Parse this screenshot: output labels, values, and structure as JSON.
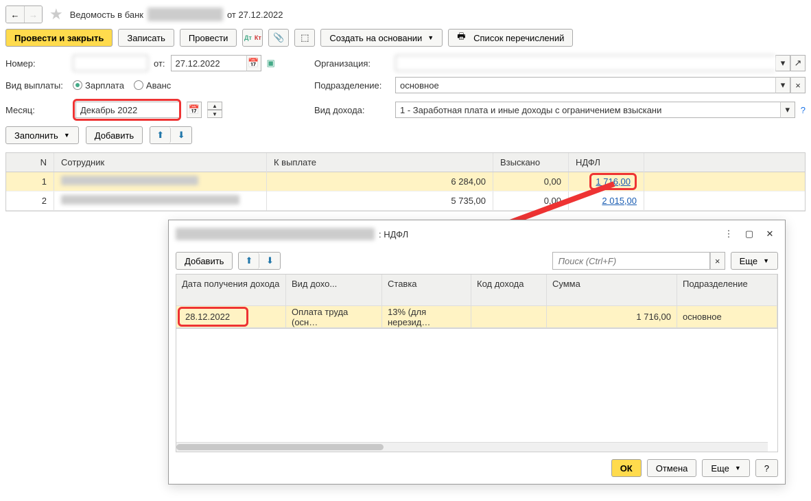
{
  "nav": {
    "back": "←",
    "forward": "→"
  },
  "title": {
    "prefix": "Ведомость в банк",
    "hidden": "████████",
    "suffix": "от 27.12.2022"
  },
  "toolbar": {
    "post_close": "Провести и закрыть",
    "write": "Записать",
    "post": "Провести",
    "dtkt": "Дт Кт",
    "create_based": "Создать на основании",
    "list_transfers": "Список перечислений"
  },
  "form": {
    "number_lbl": "Номер:",
    "number_val": "        ",
    "from_lbl": "от:",
    "date_val": "27.12.2022",
    "org_lbl": "Организация:",
    "org_val": "        ",
    "pay_type_lbl": "Вид выплаты:",
    "radio_salary": "Зарплата",
    "radio_advance": "Аванс",
    "dept_lbl": "Подразделение:",
    "dept_val": "основное",
    "month_lbl": "Месяц:",
    "month_val": "Декабрь 2022",
    "income_lbl": "Вид дохода:",
    "income_val": "1 - Заработная плата и иные доходы с ограничением взыскани"
  },
  "tbl_toolbar": {
    "fill": "Заполнить",
    "add": "Добавить"
  },
  "columns": {
    "n": "N",
    "emp": "Сотрудник",
    "pay": "К выплате",
    "col": "Взыскано",
    "ndfl": "НДФЛ"
  },
  "rows": [
    {
      "n": "1",
      "emp": "                    ",
      "pay": "6 284,00",
      "col": "0,00",
      "ndfl": "1 716,00"
    },
    {
      "n": "2",
      "emp": "                         ",
      "pay": "5 735,00",
      "col": "0,00",
      "ndfl": "2 015,00"
    }
  ],
  "dialog": {
    "title_hidden": "████████████",
    "title_suffix": ": НДФЛ",
    "add": "Добавить",
    "search_ph": "Поиск (Ctrl+F)",
    "more": "Еще",
    "cols": {
      "date": "Дата получения дохода",
      "kind": "Вид дохо...",
      "rate": "Ставка",
      "code": "Код дохода",
      "sum": "Сумма",
      "dept": "Подразделение"
    },
    "row": {
      "date": "28.12.2022",
      "kind": "Оплата труда (осн…",
      "rate": "13% (для нерезид…",
      "code": "",
      "sum": "1 716,00",
      "dept": "основное"
    },
    "ok": "ОК",
    "cancel": "Отмена",
    "help": "?"
  }
}
